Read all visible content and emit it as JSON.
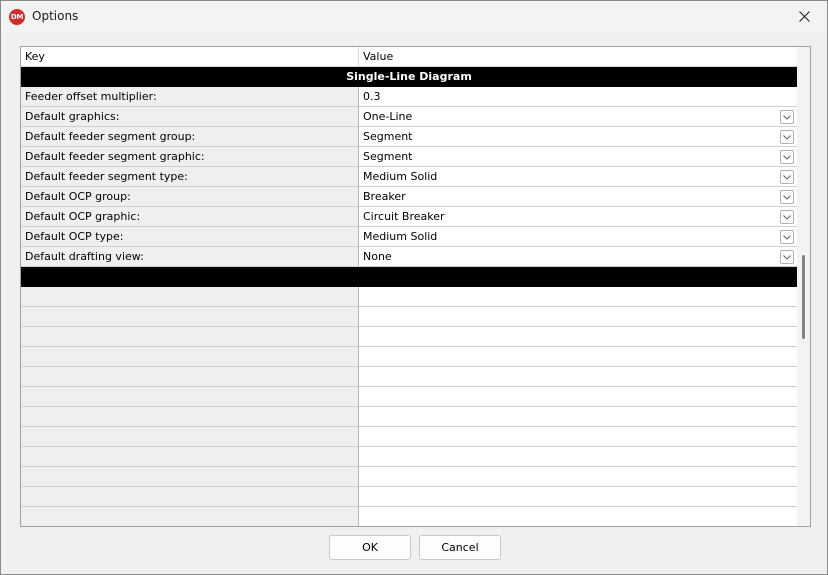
{
  "window": {
    "title": "Options",
    "app_icon_text": "DM",
    "icon": "app-logo-icon",
    "close_icon": "close-icon"
  },
  "grid": {
    "columns": {
      "key": "Key",
      "value": "Value"
    },
    "section_title": "Single-Line Diagram",
    "rows": [
      {
        "key": "Feeder offset multiplier:",
        "value": "0.3",
        "dropdown": false
      },
      {
        "key": "Default graphics:",
        "value": "One-Line",
        "dropdown": true
      },
      {
        "key": "Default feeder segment group:",
        "value": "Segment",
        "dropdown": true
      },
      {
        "key": "Default feeder segment graphic:",
        "value": "Segment",
        "dropdown": true
      },
      {
        "key": "Default feeder segment type:",
        "value": "Medium Solid",
        "dropdown": true
      },
      {
        "key": "Default OCP group:",
        "value": "Breaker",
        "dropdown": true
      },
      {
        "key": "Default OCP graphic:",
        "value": "Circuit Breaker",
        "dropdown": true
      },
      {
        "key": "Default OCP type:",
        "value": "Medium Solid",
        "dropdown": true
      },
      {
        "key": "Default drafting view:",
        "value": "None",
        "dropdown": true
      }
    ],
    "empty_row_count": 12
  },
  "buttons": {
    "ok": "OK",
    "cancel": "Cancel"
  },
  "colors": {
    "section_bg": "#000000",
    "section_text": "#ffffff",
    "key_cell_bg": "#efefef",
    "app_icon_bg": "#d62b2b"
  }
}
